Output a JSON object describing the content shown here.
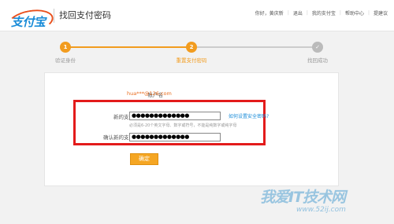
{
  "header": {
    "logo_text": "支付宝",
    "page_title": "找回支付密码",
    "nav": [
      {
        "label": "你好，黄庆新"
      },
      {
        "label": "退出"
      },
      {
        "label": "我的支付宝"
      },
      {
        "label": "帮助中心"
      },
      {
        "label": "提建议"
      }
    ]
  },
  "steps": [
    {
      "number": "1",
      "label": "验证身份",
      "state": "done"
    },
    {
      "number": "2",
      "label": "重置支付密码",
      "state": "current"
    },
    {
      "number": "✓",
      "label": "找回成功",
      "state": "pending"
    }
  ],
  "form": {
    "account_label": "账户名",
    "account_value": "hua***@126.com",
    "new_pw_label": "新的支付密码",
    "new_pw_value": "●●●●●●●●●●●●●",
    "help_link": "如何设置安全密码?",
    "hint": "必须是6-20个英文字母、数字或符号，不能是纯数字或纯字母",
    "confirm_pw_label": "确认新的支付密码",
    "confirm_pw_value": "●●●●●●●●●●●●●",
    "submit_label": "确定"
  },
  "watermark": {
    "text": "我爱IT技术网",
    "url": "www.52ij.com"
  },
  "colors": {
    "accent": "#f29c1f",
    "link": "#1a8cd8",
    "highlight": "#e31b1b"
  }
}
